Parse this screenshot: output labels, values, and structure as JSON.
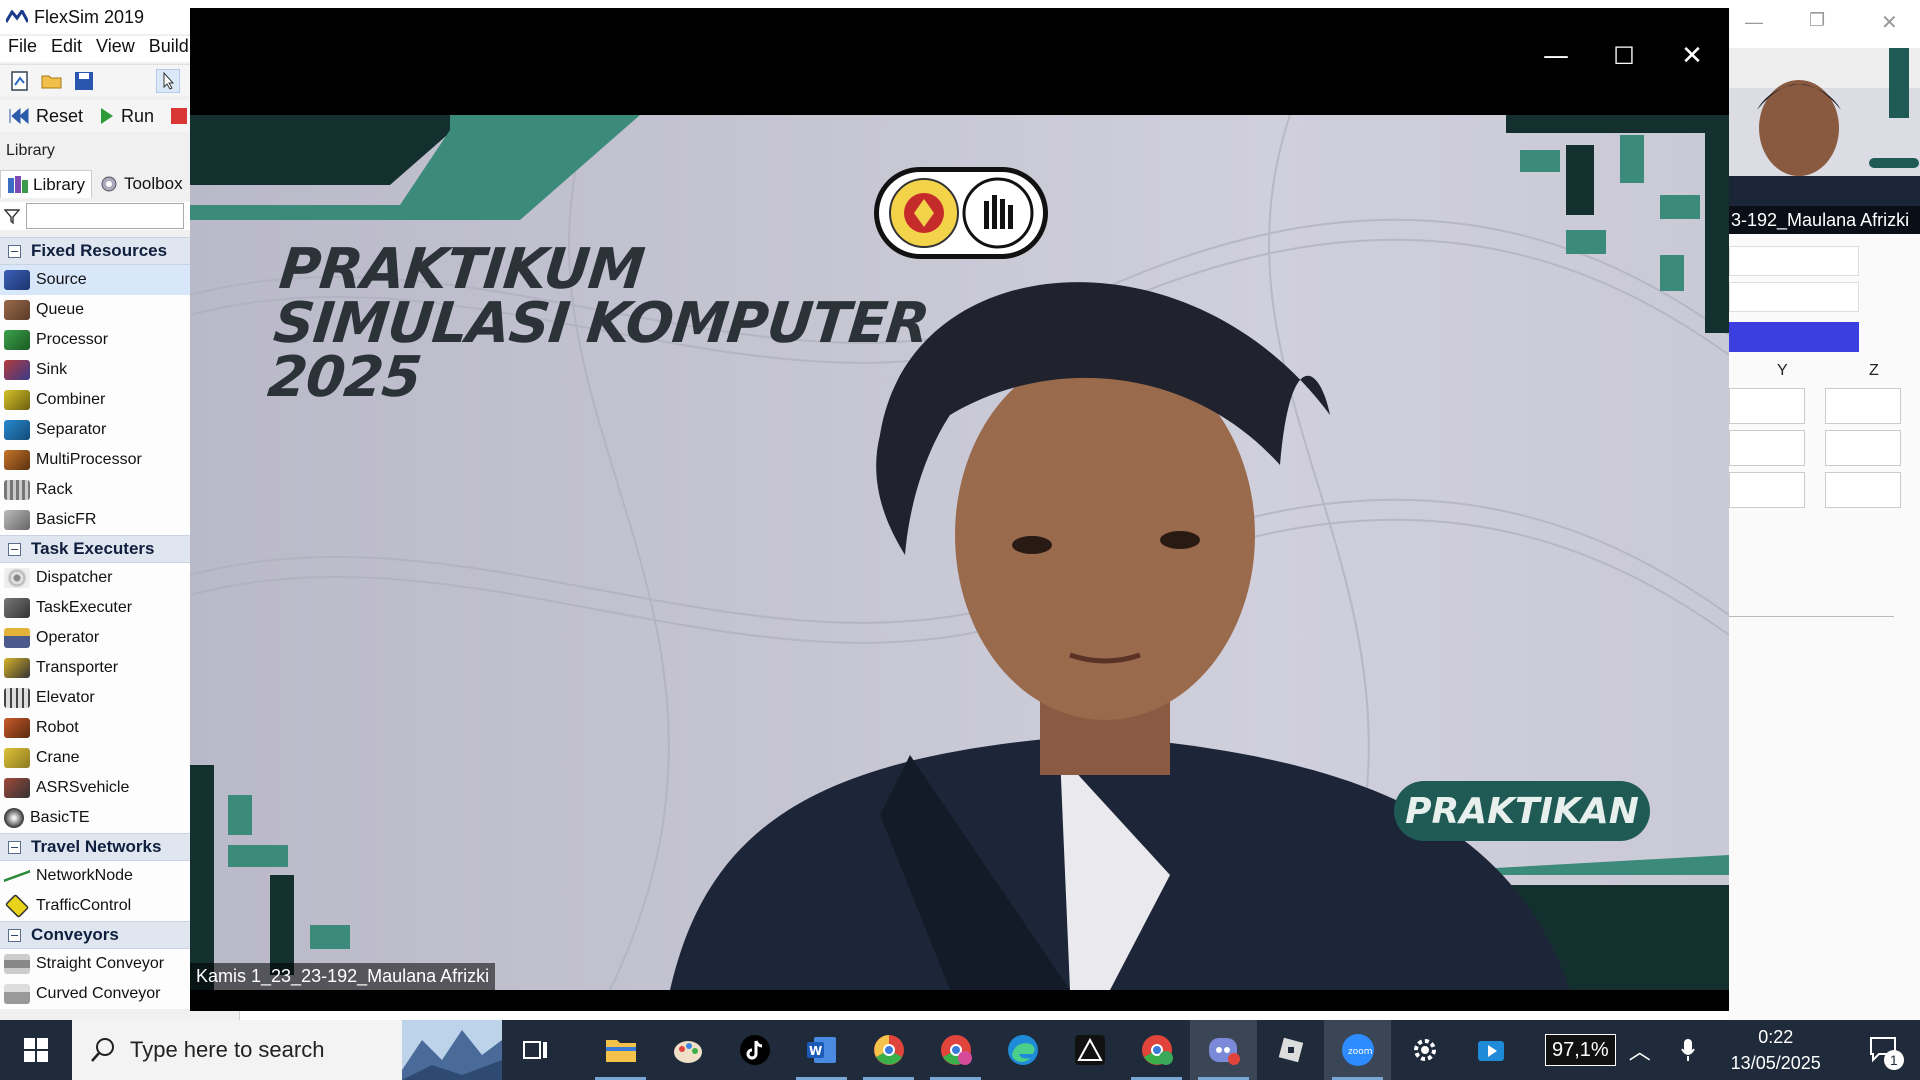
{
  "flexsim": {
    "title": "FlexSim 2019",
    "menu": [
      "File",
      "Edit",
      "View",
      "Build"
    ],
    "toolbar": {
      "reset_label": "Reset",
      "run_label": "Run"
    },
    "library_heading": "Library",
    "tabs": [
      "Library",
      "Toolbox"
    ],
    "categories": [
      {
        "name": "Fixed Resources",
        "items": [
          "Source",
          "Queue",
          "Processor",
          "Sink",
          "Combiner",
          "Separator",
          "MultiProcessor",
          "Rack",
          "BasicFR"
        ]
      },
      {
        "name": "Task Executers",
        "items": [
          "Dispatcher",
          "TaskExecuter",
          "Operator",
          "Transporter",
          "Elevator",
          "Robot",
          "Crane",
          "ASRSvehicle",
          "BasicTE"
        ]
      },
      {
        "name": "Travel Networks",
        "items": [
          "NetworkNode",
          "TrafficControl"
        ]
      },
      {
        "name": "Conveyors",
        "items": [
          "Straight Conveyor",
          "Curved Conveyor"
        ]
      }
    ],
    "selected_item": "Source",
    "properties": {
      "col_y": "Y",
      "col_z": "Z"
    }
  },
  "zoom": {
    "controls": {
      "minimize": "—",
      "maximize": "☐",
      "close": "✕"
    },
    "video": {
      "title_lines": [
        "PRAKTIKUM",
        "SIMULASI KOMPUTER",
        "2025"
      ],
      "role_badge": "PRAKTIKAN",
      "participant_name": "Kamis 1_23_23-192_Maulana Afrizki"
    },
    "gallery": {
      "participant_name": "3-192_Maulana Afrizki"
    }
  },
  "taskbar": {
    "search_placeholder": "Type here to search",
    "zoom_level": "97,1%",
    "time": "0:22",
    "date": "13/05/2025",
    "notification_count": "1",
    "apps": [
      "file-explorer",
      "paint",
      "tiktok",
      "word",
      "chrome",
      "chrome-m",
      "edge",
      "app-a",
      "chrome-n",
      "discord",
      "roblox",
      "zoom",
      "settings",
      "media-player"
    ]
  },
  "colors": {
    "taskbar_bg": "#1f2b3a",
    "video_accent": "#1f5a55",
    "category_bg": "#dfe6f0"
  }
}
